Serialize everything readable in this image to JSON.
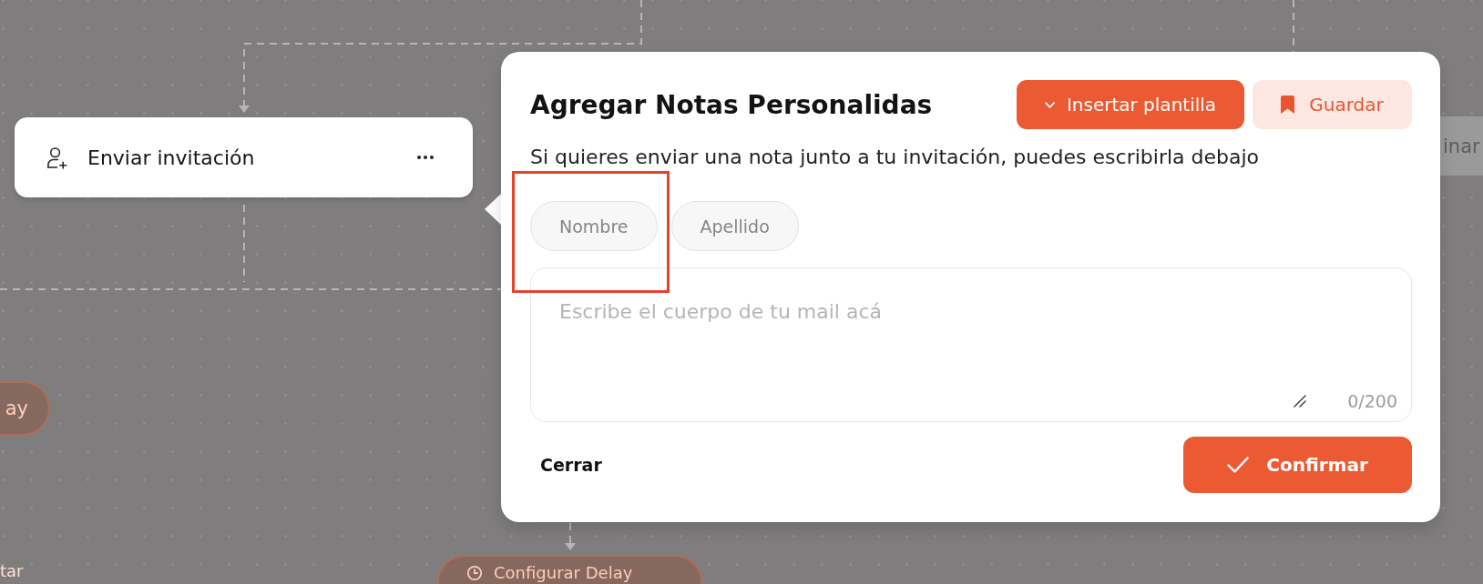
{
  "flow": {
    "nodes": [
      {
        "kind": "card",
        "label": "Enviar invitación"
      },
      {
        "kind": "pill",
        "label": "ay"
      },
      {
        "kind": "caption",
        "label": "tar"
      },
      {
        "kind": "pill",
        "label": "Configurar Delay"
      },
      {
        "kind": "button",
        "label": "inar"
      }
    ]
  },
  "dialog": {
    "title": "Agregar Notas Personalidas",
    "actions": [
      {
        "kind": "dropdown",
        "label": "Insertar plantilla"
      },
      {
        "kind": "bookmark",
        "label": "Guardar"
      }
    ],
    "description": "Si quieres enviar una nota junto a tu invitación, puedes escribirla debajo",
    "variables": [
      {
        "label": "Nombre",
        "highlighted": true
      },
      {
        "label": "Apellido",
        "highlighted": false
      }
    ],
    "body": {
      "placeholder": "Escribe el cuerpo de tu mail acá",
      "counter": "0/200"
    },
    "footer": {
      "close": "Cerrar",
      "confirm": "Confirmar"
    }
  }
}
